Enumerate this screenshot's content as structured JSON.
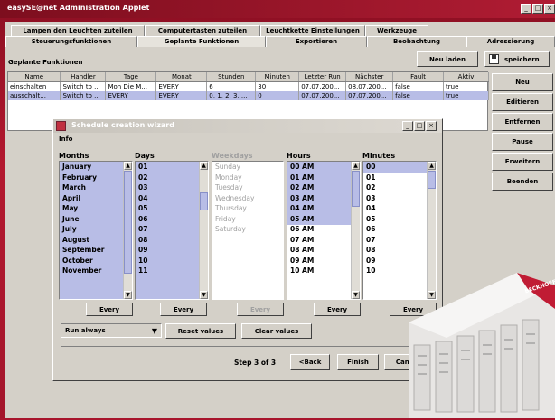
{
  "window": {
    "title": "easySE@net Administration Applet",
    "controls": [
      "_",
      "□",
      "×"
    ]
  },
  "tabs_top": [
    "Lampen den Leuchten zuteilen",
    "Computertasten zuteilen",
    "Leuchtkette Einstellungen",
    "Werkzeuge"
  ],
  "tabs_bottom": [
    "Steuerungsfunktionen",
    "Geplante Funktionen",
    "Exportieren",
    "Beobachtung",
    "Adressierung"
  ],
  "panel": {
    "heading": "Geplante Funktionen",
    "reload_label": "Neu laden",
    "save_label": "speichern"
  },
  "table": {
    "columns": [
      "Name",
      "Handler",
      "Tage",
      "Monat",
      "Stunden",
      "Minuten",
      "Letzter Run",
      "Nächster",
      "Fault",
      "Aktiv"
    ],
    "rows": [
      [
        "einschalten",
        "Switch to ...",
        "Mon Die M...",
        "EVERY",
        "6",
        "30",
        "07.07.200...",
        "08.07.200...",
        "false",
        "true"
      ],
      [
        "ausschalt...",
        "Switch to ...",
        "EVERY",
        "EVERY",
        "0, 1, 2, 3, ...",
        "0",
        "07.07.200...",
        "07.07.200...",
        "false",
        "true"
      ]
    ]
  },
  "side_buttons": [
    "Neu",
    "Editieren",
    "Entfernen",
    "Pause",
    "Erweitern",
    "Beenden"
  ],
  "dialog": {
    "title": "Schedule creation wizard",
    "info_label": "Info",
    "columns": {
      "months": {
        "header": "Months",
        "items": [
          "January",
          "February",
          "March",
          "April",
          "May",
          "June",
          "July",
          "August",
          "September",
          "October",
          "November"
        ],
        "every_label": "Every"
      },
      "days": {
        "header": "Days",
        "items": [
          "01",
          "02",
          "03",
          "04",
          "05",
          "06",
          "07",
          "08",
          "09",
          "10",
          "11"
        ],
        "every_label": "Every"
      },
      "weekdays": {
        "header": "Weekdays",
        "items": [
          "Sunday",
          "Monday",
          "Tuesday",
          "Wednesday",
          "Thursday",
          "Friday",
          "Saturday"
        ],
        "every_label": "Every"
      },
      "hours": {
        "header": "Hours",
        "items": [
          "00 AM",
          "01 AM",
          "02 AM",
          "03 AM",
          "04 AM",
          "05 AM",
          "06 AM",
          "07 AM",
          "08 AM",
          "09 AM",
          "10 AM"
        ],
        "every_label": "Every"
      },
      "minutes": {
        "header": "Minutes",
        "items": [
          "00",
          "01",
          "02",
          "03",
          "04",
          "05",
          "06",
          "07",
          "08",
          "09",
          "10"
        ],
        "every_label": "Every"
      }
    },
    "run_select": "Run always",
    "reset_label": "Reset values",
    "clear_label": "Clear values",
    "step_text": "Step 3 of 3",
    "back_label": "<Back",
    "finish_label": "Finish",
    "cancel_label": "Cancel"
  },
  "device": {
    "brand": "BECKHOFF"
  },
  "colors": {
    "background_red": "#a8142c",
    "selection_blue": "#b8bde6",
    "panel_gray": "#d4d0c8"
  }
}
